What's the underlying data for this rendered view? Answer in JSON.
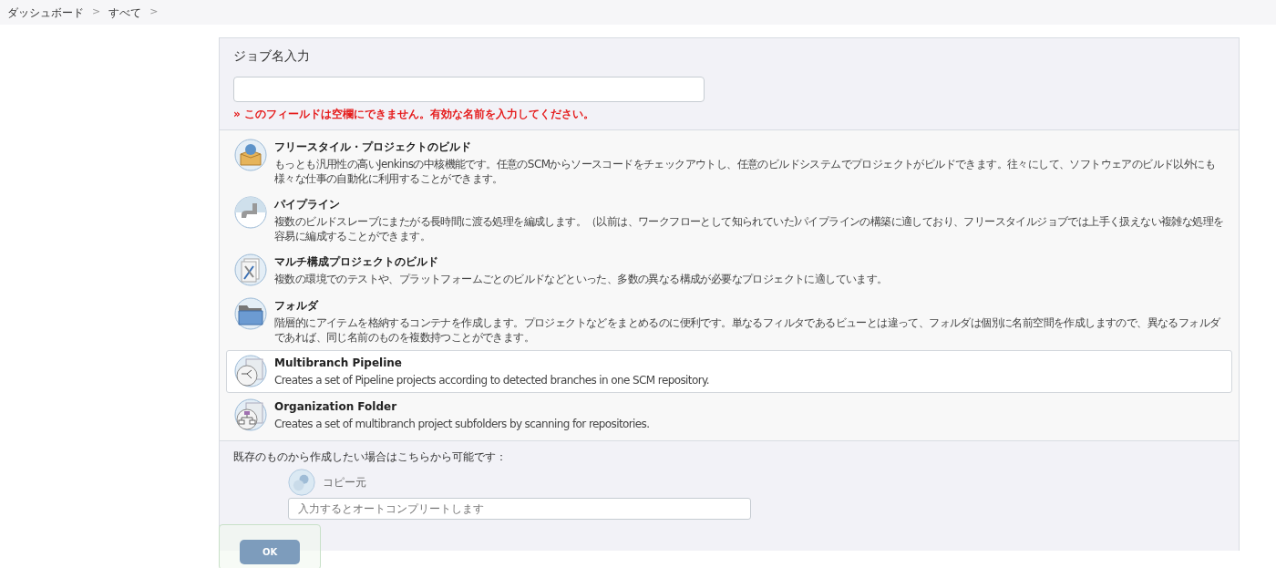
{
  "breadcrumbs": [
    {
      "label": "ダッシュボード",
      "separator": ">"
    },
    {
      "label": "すべて",
      "separator": ">"
    }
  ],
  "name_section": {
    "title": "ジョブ名入力",
    "error": "» このフィールドは空欄にできません。有効な名前を入力してください。"
  },
  "item_types": [
    {
      "kind": "freestyle",
      "title": "フリースタイル・プロジェクトのビルド",
      "description": "もっとも汎用性の高いJenkinsの中核機能です。任意のSCMからソースコードをチェックアウトし、任意のビルドシステムでプロジェクトがビルドできます。往々にして、ソフトウェアのビルド以外にも様々な仕事の自動化に利用することができます。",
      "selected": false
    },
    {
      "kind": "pipeline",
      "title": "パイプライン",
      "description": "複数のビルドスレーブにまたがる長時間に渡る処理を編成します。（以前は、ワークフローとして知られていた)パイプラインの構築に適しており、フリースタイルジョブでは上手く扱えない複雑な処理を容易に編成することができます。",
      "selected": false
    },
    {
      "kind": "matrix",
      "title": "マルチ構成プロジェクトのビルド",
      "description": "複数の環境でのテストや、プラットフォームごとのビルドなどといった、多数の異なる構成が必要なプロジェクトに適しています。",
      "selected": false
    },
    {
      "kind": "folder",
      "title": "フォルダ",
      "description": "階層的にアイテムを格納するコンテナを作成します。プロジェクトなどをまとめるのに便利です。単なるフィルタであるビューとは違って、フォルダは個別に名前空間を作成しますので、異なるフォルダであれば、同じ名前のものを複数持つことができます。",
      "selected": false
    },
    {
      "kind": "multibranch",
      "title": "Multibranch Pipeline",
      "description": "Creates a set of Pipeline projects according to detected branches in one SCM repository.",
      "selected": true
    },
    {
      "kind": "orgfolder",
      "title": "Organization Folder",
      "description": "Creates a set of multibranch project subfolders by scanning for repositories.",
      "selected": false
    }
  ],
  "copy_section": {
    "intro": "既存のものから作成したい場合はこちらから可能です：",
    "label": "コピー元",
    "placeholder": "入力するとオートコンプリートします"
  },
  "footer": {
    "ok_button": "OK"
  }
}
